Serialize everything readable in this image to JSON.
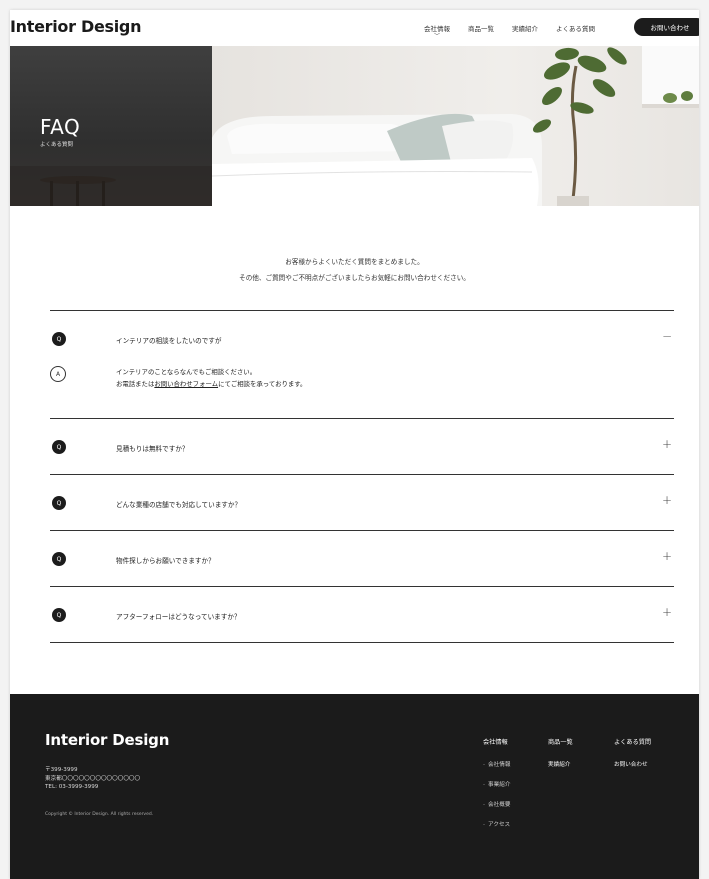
{
  "header": {
    "logo": "Interior Design",
    "nav": [
      "会社情報",
      "商品一覧",
      "実績紹介",
      "よくある質問"
    ],
    "contact_label": "お問い合わせ"
  },
  "hero": {
    "title": "FAQ",
    "subtitle": "よくある質問"
  },
  "intro": {
    "line1": "お客様からよくいただく質問をまとめました。",
    "line2": "その他、ご質問やご不明点がございましたらお気軽にお問い合わせください。"
  },
  "faq": {
    "q_badge": "Q",
    "a_badge": "A",
    "items": [
      {
        "question": "インテリアの相談をしたいのですが",
        "expanded": true,
        "toggle": "−",
        "answer_line1": "インテリアのことならなんでもご相談ください。",
        "answer_pre": "お電話または",
        "answer_link": "お問い合わせフォーム",
        "answer_post": "にてご相談を承っております。"
      },
      {
        "question": "見積もりは無料ですか？",
        "toggle": "+"
      },
      {
        "question": "どんな業種の店舗でも対応していますか？",
        "toggle": "+"
      },
      {
        "question": "物件探しからお願いできますか？",
        "toggle": "+"
      },
      {
        "question": "アフターフォローはどうなっていますか？",
        "toggle": "+"
      }
    ]
  },
  "footer": {
    "logo": "Interior Design",
    "postal": "〒399-3999",
    "address": "東京都〇〇〇〇〇〇〇〇〇〇〇〇〇〇",
    "tel": "TEL: 03-3999-3999",
    "copyright": "Copyright © Interior Design. All rights reserved.",
    "col1_head": "会社情報",
    "col1_subs": [
      "会社情報",
      "事業紹介",
      "会社概要",
      "アクセス"
    ],
    "col2_head": "商品一覧",
    "col2_sub": "実績紹介",
    "col3_head": "よくある質問",
    "col3_sub": "お問い合わせ"
  },
  "colors": {
    "dark": "#1c1c1c",
    "footer_bg": "#1b1b1b",
    "hero_panel": "#3a3a3a"
  }
}
